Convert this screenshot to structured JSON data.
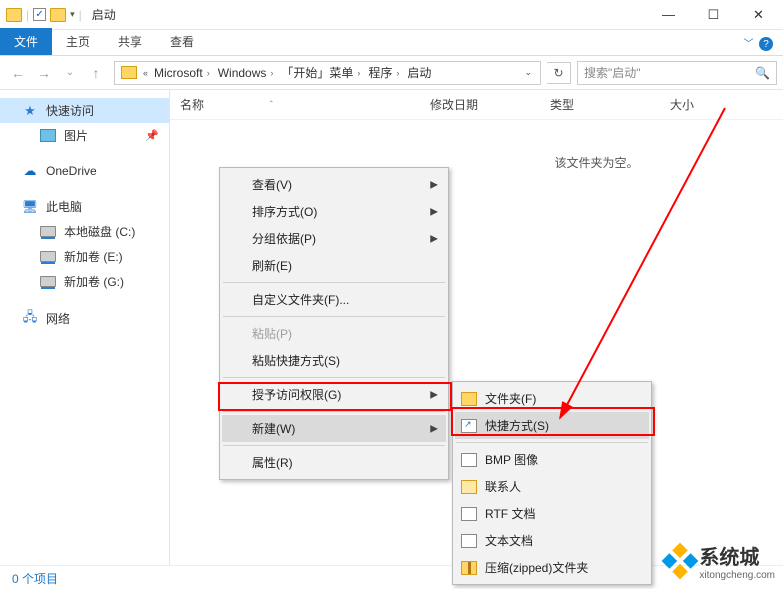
{
  "window": {
    "title": "启动"
  },
  "winbtns": {
    "min": "—",
    "max": "☐",
    "close": "✕"
  },
  "ribbon": {
    "file": "文件",
    "home": "主页",
    "share": "共享",
    "view": "查看",
    "expand_icon": "﹀",
    "help_icon": "?"
  },
  "nav": {
    "back": "←",
    "fwd": "→",
    "dropdown": "⌄",
    "up": "↑",
    "refresh": "↻"
  },
  "breadcrumbs": {
    "sep": "›",
    "items": [
      "Microsoft",
      "Windows",
      "「开始」菜单",
      "程序",
      "启动"
    ],
    "drop": "⌄"
  },
  "search": {
    "placeholder": "搜索\"启动\"",
    "icon": "🔍"
  },
  "sidebar": {
    "quick": "快速访问",
    "pics": "图片",
    "onedrive": "OneDrive",
    "thispc": "此电脑",
    "localdisk": "本地磁盘 (C:)",
    "vol_e": "新加卷 (E:)",
    "vol_g": "新加卷 (G:)",
    "network": "网络",
    "pin": "📌"
  },
  "columns": {
    "name": "名称",
    "sort": "ˆ",
    "date": "修改日期",
    "type": "类型",
    "size": "大小"
  },
  "empty": "该文件夹为空。",
  "status": "0 个项目",
  "ctx1": {
    "view": "查看(V)",
    "sort": "排序方式(O)",
    "group": "分组依据(P)",
    "refresh": "刷新(E)",
    "customize": "自定义文件夹(F)...",
    "paste": "粘贴(P)",
    "pastelnk": "粘贴快捷方式(S)",
    "grant": "授予访问权限(G)",
    "new": "新建(W)",
    "props": "属性(R)"
  },
  "ctx2": {
    "folder": "文件夹(F)",
    "shortcut": "快捷方式(S)",
    "bmp": "BMP 图像",
    "contact": "联系人",
    "rtf": "RTF 文档",
    "txt": "文本文档",
    "zip": "压缩(zipped)文件夹"
  },
  "watermark": {
    "brand": "系统城",
    "url": "xitongcheng.com"
  }
}
